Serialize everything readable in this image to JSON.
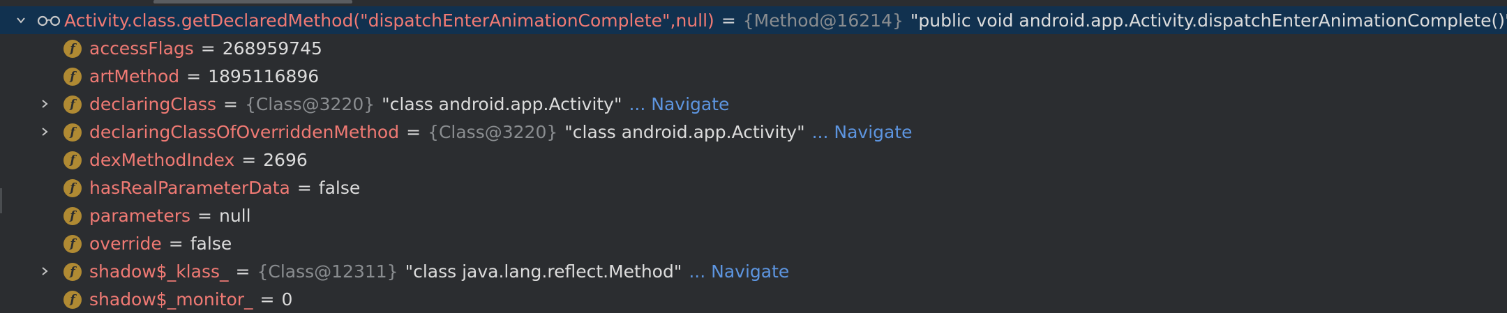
{
  "root": {
    "name": "Activity.class.getDeclaredMethod(\"dispatchEnterAnimationComplete\",null)",
    "equals": "=",
    "ref": "{Method@16214}",
    "value": "\"public void android.app.Activity.dispatchEnterAnimationComplete()\""
  },
  "fields": [
    {
      "name": "accessFlags",
      "equals": "=",
      "value": "268959745",
      "ref": "",
      "navigate": "",
      "expandable": false
    },
    {
      "name": "artMethod",
      "equals": "=",
      "value": "1895116896",
      "ref": "",
      "navigate": "",
      "expandable": false
    },
    {
      "name": "declaringClass",
      "equals": "=",
      "ref": "{Class@3220}",
      "value": "\"class android.app.Activity\"",
      "navigate": "... Navigate",
      "expandable": true
    },
    {
      "name": "declaringClassOfOverriddenMethod",
      "equals": "=",
      "ref": "{Class@3220}",
      "value": "\"class android.app.Activity\"",
      "navigate": "... Navigate",
      "expandable": true
    },
    {
      "name": "dexMethodIndex",
      "equals": "=",
      "value": "2696",
      "ref": "",
      "navigate": "",
      "expandable": false
    },
    {
      "name": "hasRealParameterData",
      "equals": "=",
      "value": "false",
      "ref": "",
      "navigate": "",
      "expandable": false
    },
    {
      "name": "parameters",
      "equals": "=",
      "value": "null",
      "ref": "",
      "navigate": "",
      "expandable": false
    },
    {
      "name": "override",
      "equals": "=",
      "value": "false",
      "ref": "",
      "navigate": "",
      "expandable": false
    },
    {
      "name": "shadow$_klass_",
      "equals": "=",
      "ref": "{Class@12311}",
      "value": "\"class java.lang.reflect.Method\"",
      "navigate": "... Navigate",
      "expandable": true
    },
    {
      "name": "shadow$_monitor_",
      "equals": "=",
      "value": "0",
      "ref": "",
      "navigate": "",
      "expandable": false
    }
  ],
  "field_icon_letter": "f",
  "colors": {
    "background": "#2b2d30",
    "selected_row": "#11314f",
    "field_name": "#f07a74",
    "object_ref": "#8a8d90",
    "navigate_link": "#5d95e0",
    "field_icon": "#b08a33"
  },
  "icons": {
    "root_expander": "chevron-down-icon",
    "root_kind": "watch-glasses-icon",
    "field_kind": "field-icon",
    "field_expander": "chevron-right-icon"
  }
}
